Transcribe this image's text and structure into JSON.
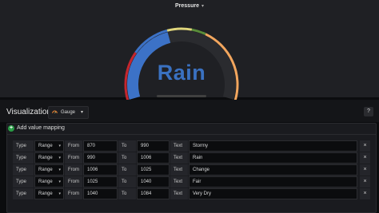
{
  "panel": {
    "title": "Pressure",
    "gauge": {
      "value_text": "Rain",
      "value_color": "#3a71c1",
      "fill_fraction": 0.43,
      "colors": {
        "threshold_red": "#c4262e",
        "threshold_blue": "#3c72c7",
        "threshold_yellow": "#e0d67c",
        "threshold_green": "#5a8d3a",
        "threshold_orange": "#f2a65e",
        "track": "#2a2b2f"
      }
    }
  },
  "visualization": {
    "title": "Visualization",
    "picker_label": "Gauge",
    "picker_icon": "gauge-icon",
    "help_label": "?"
  },
  "value_mappings": {
    "add_label": "Add value mapping",
    "add_icon": "plus-circle-icon",
    "rows": [
      {
        "type_label": "Type",
        "type_value": "Range",
        "from_label": "From",
        "from_value": "870",
        "to_label": "To",
        "to_value": "990",
        "text_label": "Text",
        "text_value": "Stormy",
        "delete_label": "×"
      },
      {
        "type_label": "Type",
        "type_value": "Range",
        "from_label": "From",
        "from_value": "990",
        "to_label": "To",
        "to_value": "1006",
        "text_label": "Text",
        "text_value": "Rain",
        "delete_label": "×"
      },
      {
        "type_label": "Type",
        "type_value": "Range",
        "from_label": "From",
        "from_value": "1006",
        "to_label": "To",
        "to_value": "1025",
        "text_label": "Text",
        "text_value": "Change",
        "delete_label": "×"
      },
      {
        "type_label": "Type",
        "type_value": "Range",
        "from_label": "From",
        "from_value": "1025",
        "to_label": "To",
        "to_value": "1040",
        "text_label": "Text",
        "text_value": "Fair",
        "delete_label": "×"
      },
      {
        "type_label": "Type",
        "type_value": "Range",
        "from_label": "From",
        "from_value": "1040",
        "to_label": "To",
        "to_value": "1084",
        "text_label": "Text",
        "text_value": "Very Dry",
        "delete_label": "×"
      }
    ]
  }
}
